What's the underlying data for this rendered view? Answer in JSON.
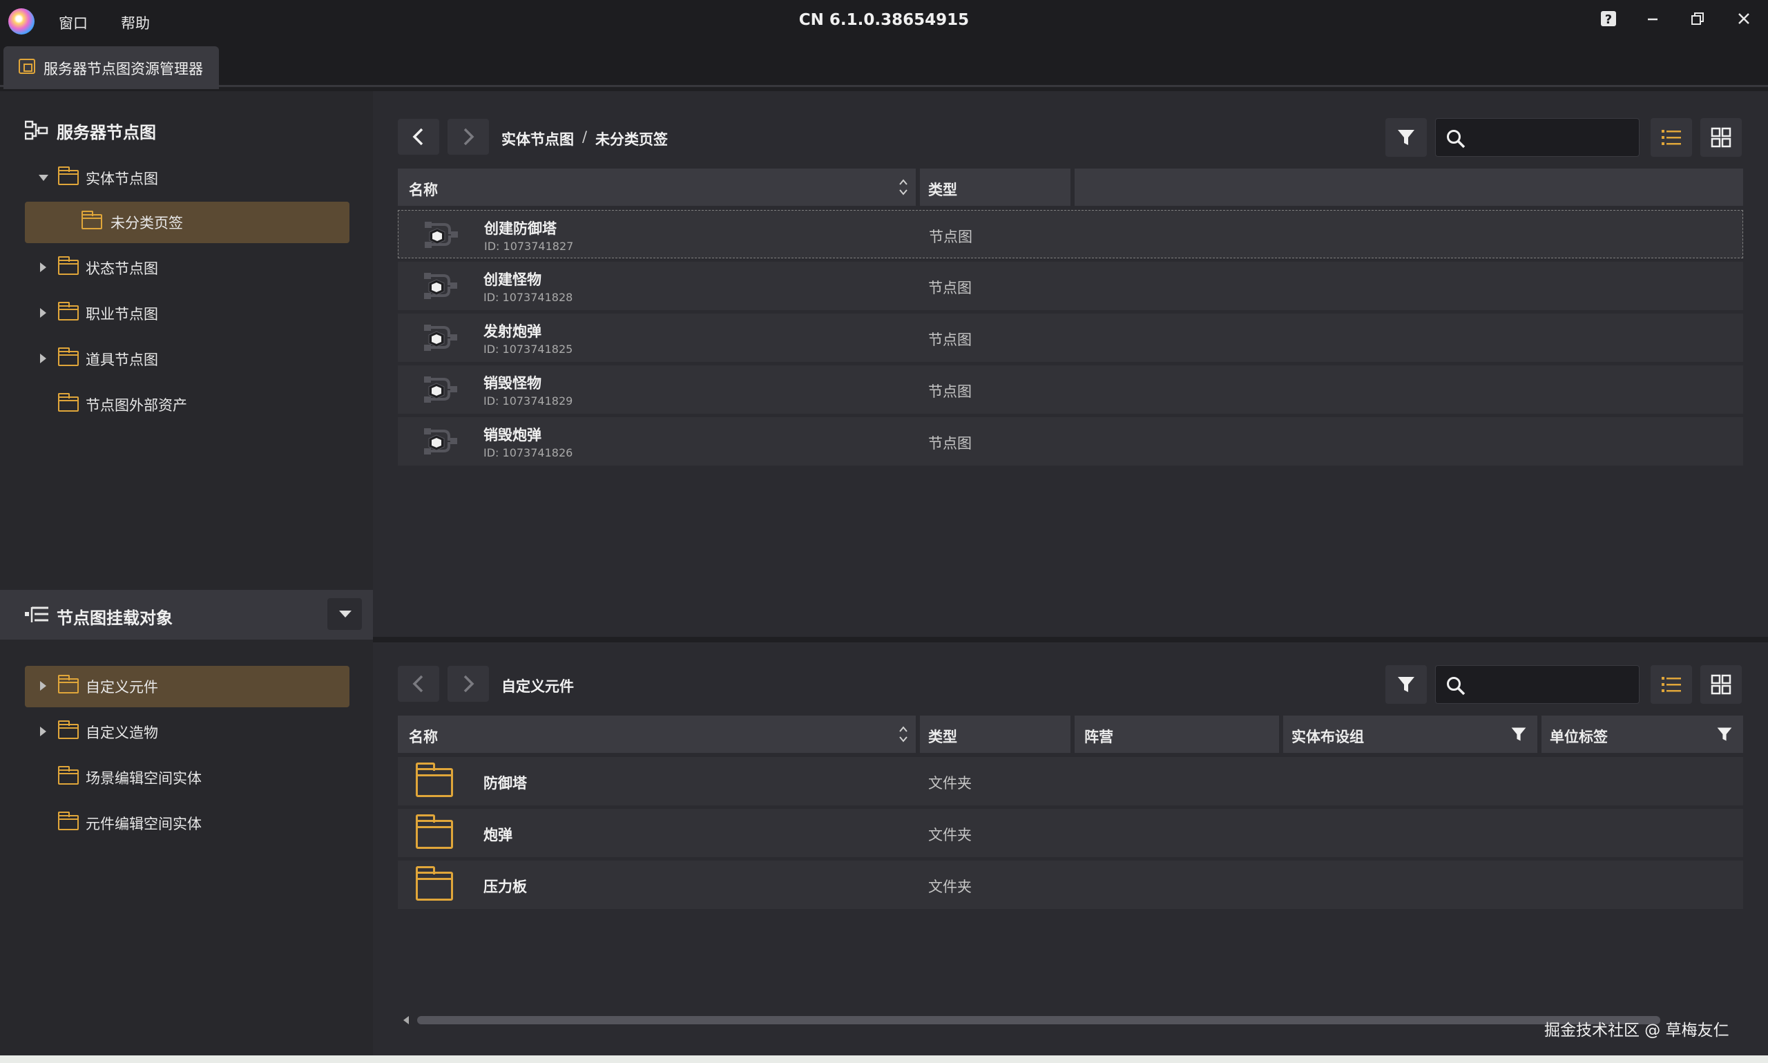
{
  "titlebar": {
    "menus": [
      "窗口",
      "帮助"
    ],
    "version": "CN 6.1.0.38654915"
  },
  "tab": {
    "label": "服务器节点图资源管理器"
  },
  "sidebar": {
    "title": "服务器节点图",
    "tree": [
      {
        "label": "实体节点图",
        "expanded": true
      },
      {
        "label": "未分类页签",
        "selected": true
      },
      {
        "label": "状态节点图",
        "expanded": false
      },
      {
        "label": "职业节点图",
        "expanded": false
      },
      {
        "label": "道具节点图",
        "expanded": false
      },
      {
        "label": "节点图外部资产"
      }
    ],
    "mount": {
      "title": "节点图挂载对象",
      "tree": [
        {
          "label": "自定义元件",
          "selected": true,
          "expanded": false
        },
        {
          "label": "自定义造物",
          "expanded": false
        },
        {
          "label": "场景编辑空间实体"
        },
        {
          "label": "元件编辑空间实体"
        }
      ]
    }
  },
  "top_pane": {
    "breadcrumb": [
      "实体节点图",
      "未分类页签"
    ],
    "breadcrumb_sep": "/",
    "search": {
      "placeholder": "",
      "value": ""
    },
    "columns": [
      "名称",
      "类型"
    ],
    "rows": [
      {
        "name": "创建防御塔",
        "id": "ID: 1073741827",
        "type": "节点图"
      },
      {
        "name": "创建怪物",
        "id": "ID: 1073741828",
        "type": "节点图"
      },
      {
        "name": "发射炮弹",
        "id": "ID: 1073741825",
        "type": "节点图"
      },
      {
        "name": "销毁怪物",
        "id": "ID: 1073741829",
        "type": "节点图"
      },
      {
        "name": "销毁炮弹",
        "id": "ID: 1073741826",
        "type": "节点图"
      }
    ]
  },
  "bottom_pane": {
    "breadcrumb": [
      "自定义元件"
    ],
    "search": {
      "placeholder": "",
      "value": ""
    },
    "columns": [
      "名称",
      "类型",
      "阵营",
      "实体布设组",
      "单位标签"
    ],
    "rows": [
      {
        "name": "防御塔",
        "type": "文件夹"
      },
      {
        "name": "炮弹",
        "type": "文件夹"
      },
      {
        "name": "压力板",
        "type": "文件夹"
      }
    ]
  },
  "watermark": "掘金技术社区 @ 草梅友仁",
  "colors": {
    "accent": "#e0a63a",
    "selected_bg": "#5b4a33",
    "pane_bg": "#2b2b30"
  }
}
